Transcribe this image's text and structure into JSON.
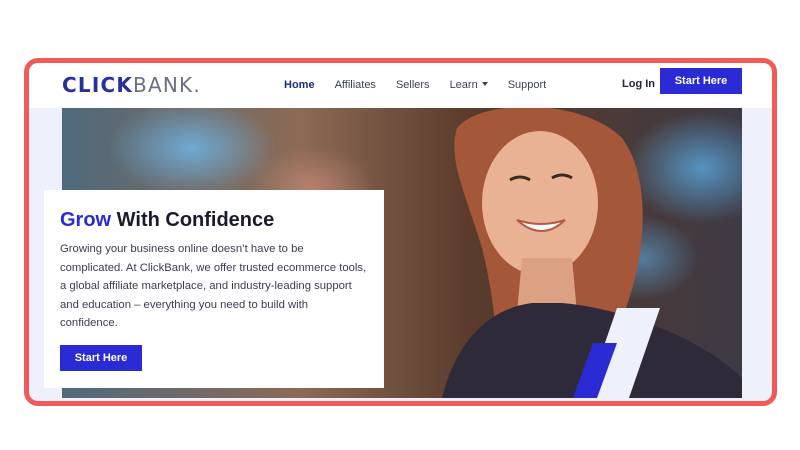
{
  "brand": {
    "logo_bold": "CLICK",
    "logo_light": "BANK."
  },
  "nav": {
    "items": [
      {
        "label": "Home",
        "active": true
      },
      {
        "label": "Affiliates"
      },
      {
        "label": "Sellers"
      },
      {
        "label": "Learn",
        "has_dropdown": true
      },
      {
        "label": "Support"
      }
    ],
    "login_label": "Log In",
    "cta_label": "Start Here"
  },
  "hero": {
    "headline_accent": "Grow",
    "headline_rest": " With Confidence",
    "body": "Growing your business online doesn’t have to be complicated. At ClickBank, we offer trusted ecommerce tools, a global affiliate marketplace, and industry-leading support and education – everything you need to build with confidence.",
    "cta_label": "Start Here"
  },
  "colors": {
    "brand_blue": "#2b2bd6",
    "frame_red": "#f25a5a",
    "logo_navy": "#2a2f9e"
  }
}
